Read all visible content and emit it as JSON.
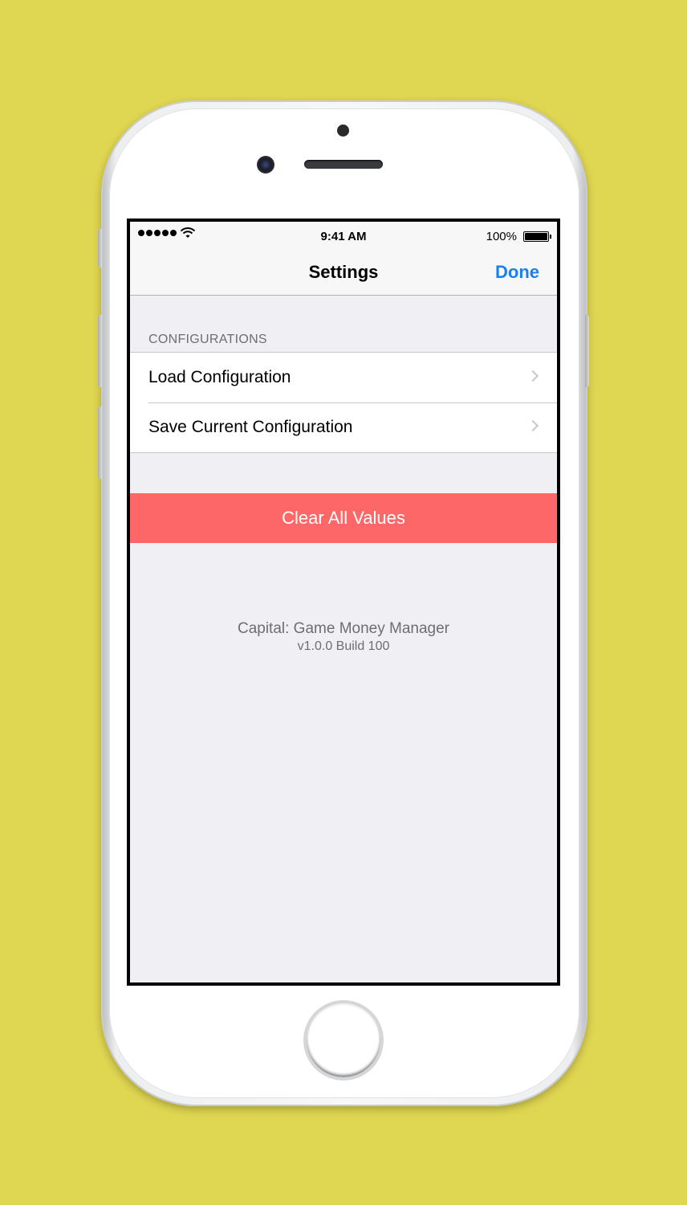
{
  "status_bar": {
    "time": "9:41 AM",
    "battery": "100%",
    "signal_icon": "signal-dots-icon",
    "wifi_icon": "wifi-icon",
    "battery_icon": "battery-icon"
  },
  "nav": {
    "title": "Settings",
    "done_label": "Done"
  },
  "configurations": {
    "header": "CONFIGURATIONS",
    "items": [
      {
        "label": "Load Configuration",
        "icon": "chevron-right-icon"
      },
      {
        "label": "Save Current Configuration",
        "icon": "chevron-right-icon"
      }
    ]
  },
  "clear_button": {
    "label": "Clear All Values",
    "color": "#fe6767"
  },
  "app_info": {
    "name": "Capital: Game Money Manager",
    "version": "v1.0.0 Build 100"
  },
  "colors": {
    "background": "#dfd651",
    "accent": "#1a7ff0",
    "destructive": "#fe6767"
  }
}
